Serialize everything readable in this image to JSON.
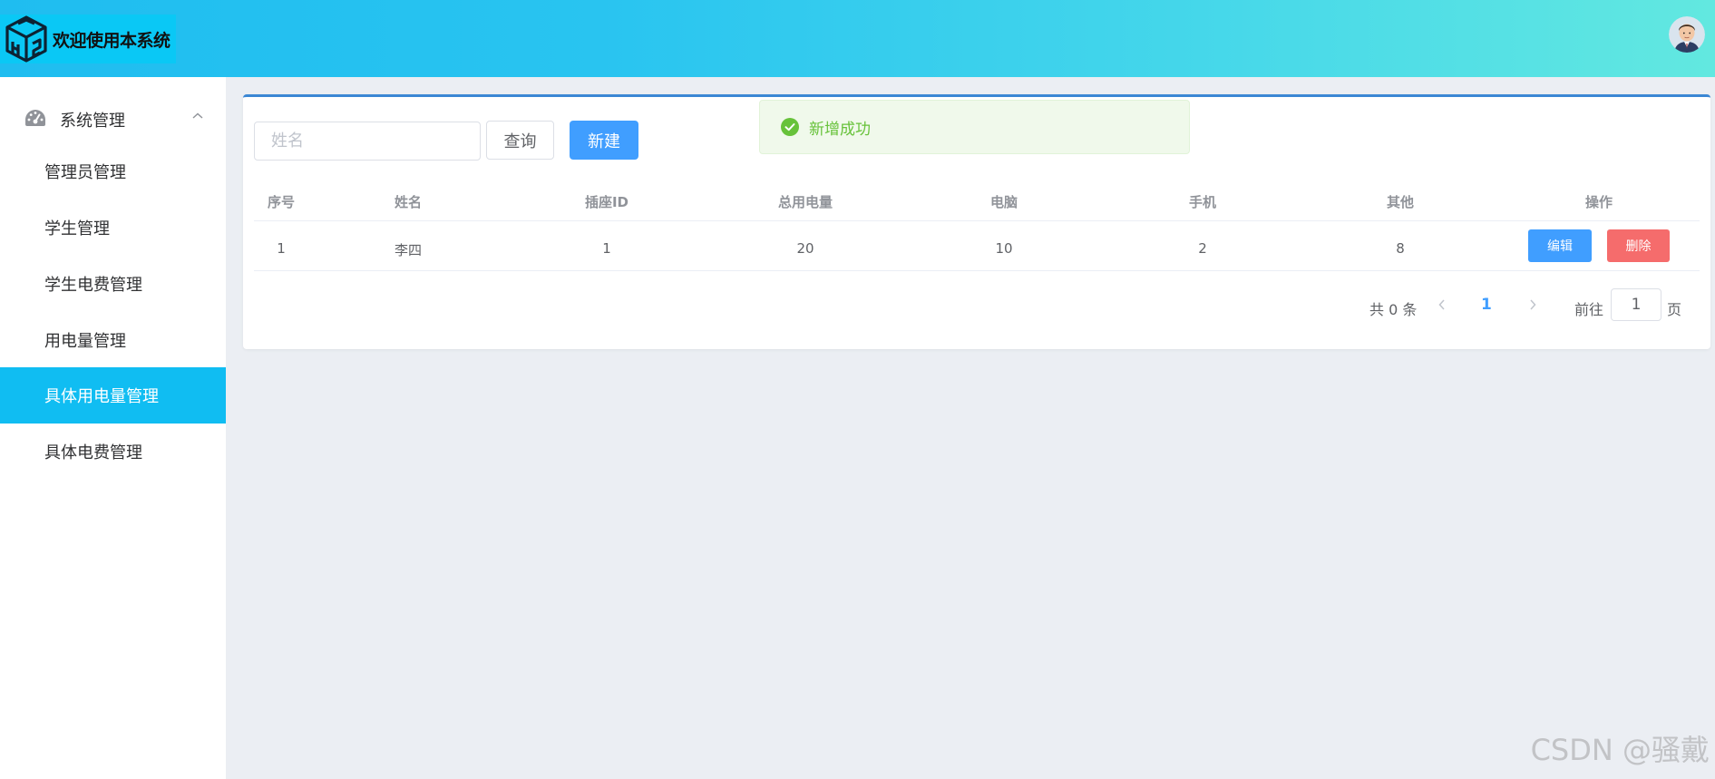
{
  "header": {
    "title": "欢迎使用本系统",
    "logo_icon": "cube-logo-icon",
    "avatar_icon": "user-avatar-icon",
    "gradient_colors": [
      "#1fbdf0",
      "#62e8e0"
    ]
  },
  "sidebar": {
    "group_label": "系统管理",
    "group_icon": "dashboard-gauge-icon",
    "group_state_icon": "chevron-up-icon",
    "items": [
      {
        "label": "管理员管理",
        "active": false
      },
      {
        "label": "学生管理",
        "active": false
      },
      {
        "label": "学生电费管理",
        "active": false
      },
      {
        "label": "用电量管理",
        "active": false
      },
      {
        "label": "具体用电量管理",
        "active": true
      },
      {
        "label": "具体电费管理",
        "active": false
      }
    ],
    "active_color": "#10bdf2"
  },
  "toolbar": {
    "search_placeholder": "姓名",
    "query_label": "查询",
    "new_label": "新建",
    "primary_color": "#409eff"
  },
  "table": {
    "headers": [
      "序号",
      "姓名",
      "插座ID",
      "总用电量",
      "电脑",
      "手机",
      "其他",
      "操作"
    ],
    "rows": [
      {
        "cells": [
          "1",
          "李四",
          "1",
          "20",
          "10",
          "2",
          "8"
        ],
        "edit_label": "编辑",
        "delete_label": "删除"
      }
    ],
    "danger_color": "#f56c6c"
  },
  "pagination": {
    "total_text": "共 0 条",
    "current_page": "1",
    "goto_label": "前往",
    "goto_value": "1",
    "page_suffix": "页"
  },
  "toast": {
    "message": "新增成功",
    "icon": "success-check-circle-icon",
    "color": "#67c23a"
  },
  "watermark": "CSDN @骚戴"
}
